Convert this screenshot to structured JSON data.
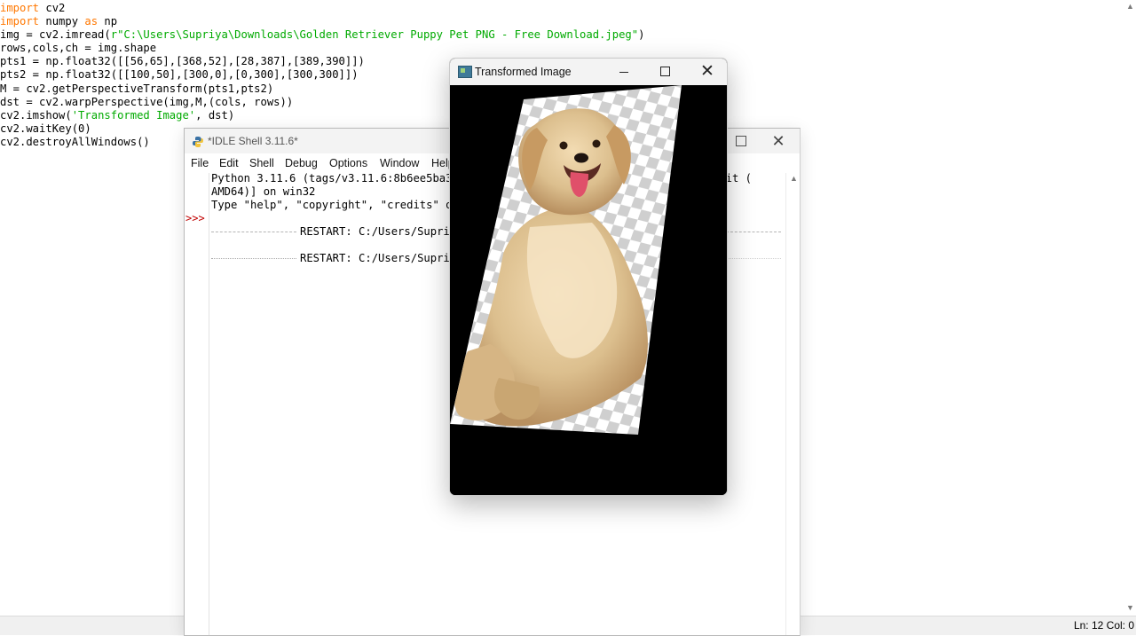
{
  "editor": {
    "lines": [
      [
        {
          "t": "import",
          "c": "kw"
        },
        {
          "t": " cv2"
        }
      ],
      [
        {
          "t": "import",
          "c": "kw"
        },
        {
          "t": " numpy "
        },
        {
          "t": "as",
          "c": "kw"
        },
        {
          "t": " np"
        }
      ],
      [
        {
          "t": "img = cv2.imread("
        },
        {
          "t": "r\"C:\\Users\\Supriya\\Downloads\\Golden Retriever Puppy Pet PNG - Free Download.jpeg\"",
          "c": "st"
        },
        {
          "t": ")"
        }
      ],
      [
        {
          "t": "rows,cols,ch = img.shape"
        }
      ],
      [
        {
          "t": "pts1 = np.float32([[56,65],[368,52],[28,387],[389,390]])"
        }
      ],
      [
        {
          "t": "pts2 = np.float32([[100,50],[300,0],[0,300],[300,300]])"
        }
      ],
      [
        {
          "t": "M = cv2.getPerspectiveTransform(pts1,pts2)"
        }
      ],
      [
        {
          "t": "dst = cv2.warpPerspective(img,M,(cols, rows))"
        }
      ],
      [
        {
          "t": "cv2.imshow("
        },
        {
          "t": "'Transformed Image'",
          "c": "st"
        },
        {
          "t": ", dst)"
        }
      ],
      [
        {
          "t": "cv2.waitKey(0)"
        }
      ],
      [
        {
          "t": "cv2.destroyAllWindows()"
        }
      ]
    ],
    "status": "Ln: 12  Col: 0"
  },
  "shell": {
    "title": "*IDLE Shell 3.11.6*",
    "menu": [
      "File",
      "Edit",
      "Shell",
      "Debug",
      "Options",
      "Window",
      "Help"
    ],
    "prompt": ">>>",
    "output_lines": [
      "Python 3.11.6 (tags/v3.11.6:8b6ee5ba3b, Oct  2 2023, 14:57:12) [MSC v.1935 64 bit (",
      "AMD64)] on win32",
      "Type \"help\", \"copyright\", \"credits\" or \"license()\" for more information."
    ],
    "restart_lines": [
      "RESTART: C:/Users/Supriya/Desktop/perspective.py",
      "RESTART: C:/Users/Supriya/Desktop/perspective.py"
    ]
  },
  "image_window": {
    "title": "Transformed Image",
    "image_subject": "golden retriever puppy on transparency checkerboard, perspective-warped"
  },
  "icons": {
    "minimize": "minimize-icon",
    "maximize": "maximize-icon",
    "close": "close-icon"
  },
  "colors": {
    "keyword": "#ff7700",
    "string": "#00aa00",
    "prompt": "#c00000",
    "canvas_bg": "#000000"
  }
}
